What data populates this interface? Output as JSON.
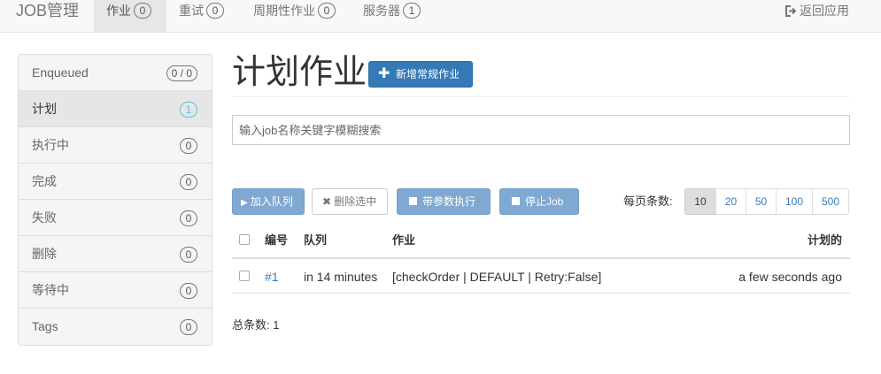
{
  "nav": {
    "brand": "JOB管理",
    "items": [
      {
        "label": "作业",
        "count": "0"
      },
      {
        "label": "重试",
        "count": "0"
      },
      {
        "label": "周期性作业",
        "count": "0"
      },
      {
        "label": "服务器",
        "count": "1"
      }
    ],
    "back": "返回应用"
  },
  "sidebar": {
    "items": [
      {
        "label": "Enqueued",
        "count": "0 / 0"
      },
      {
        "label": "计划",
        "count": "1"
      },
      {
        "label": "执行中",
        "count": "0"
      },
      {
        "label": "完成",
        "count": "0"
      },
      {
        "label": "失败",
        "count": "0"
      },
      {
        "label": "删除",
        "count": "0"
      },
      {
        "label": "等待中",
        "count": "0"
      },
      {
        "label": "Tags",
        "count": "0"
      }
    ]
  },
  "main": {
    "title": "计划作业",
    "new_button": "新增常规作业",
    "search_placeholder": "输入job名称关键字模糊搜索",
    "actions": {
      "enqueue": "加入队列",
      "delete": "删除选中",
      "run_params": "带参数执行",
      "stop": "停止Job"
    },
    "per_page_label": "每页条数:",
    "per_page_options": [
      "10",
      "20",
      "50",
      "100",
      "500"
    ],
    "per_page_selected": "10",
    "table": {
      "headers": [
        "编号",
        "队列",
        "作业",
        "计划的"
      ],
      "rows": [
        {
          "id": "#1",
          "queue": "in 14 minutes",
          "job": "[checkOrder | DEFAULT | Retry:False]",
          "scheduled": "a few seconds ago"
        }
      ]
    },
    "total": "总条数: 1"
  },
  "colors": {
    "primary": "#337ab7",
    "primary_disabled": "#7fa9d3",
    "info_badge": "#5bc0de"
  }
}
